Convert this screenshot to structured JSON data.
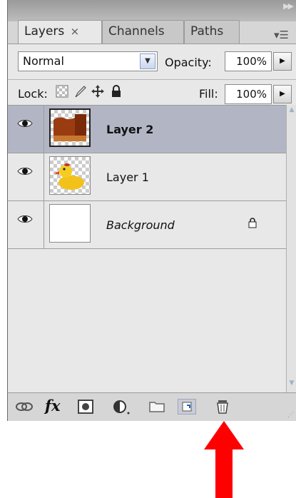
{
  "tabs": [
    {
      "label": "Layers",
      "close": "×",
      "active": true
    },
    {
      "label": "Channels",
      "active": false
    },
    {
      "label": "Paths",
      "active": false
    }
  ],
  "controls": {
    "blend_mode": "Normal",
    "opacity_label": "Opacity:",
    "opacity_value": "100%",
    "lock_label": "Lock:",
    "fill_label": "Fill:",
    "fill_value": "100%"
  },
  "layers": [
    {
      "name": "Layer 2",
      "visible": true,
      "selected": true,
      "thumbnail": "brown-image-thumbnail"
    },
    {
      "name": "Layer 1",
      "visible": true,
      "selected": false,
      "thumbnail": "rubber-duck-thumbnail"
    },
    {
      "name": "Background",
      "visible": true,
      "selected": false,
      "locked": true,
      "thumbnail": "white-thumbnail"
    }
  ],
  "footer_icons": [
    "link-layers-icon",
    "fx-icon",
    "layer-mask-icon",
    "adjustment-layer-icon",
    "group-folder-icon",
    "new-layer-icon",
    "trash-icon"
  ],
  "footer": {
    "fx_label": "fx"
  },
  "annotation": {
    "arrow_color": "#ff0000"
  },
  "colors": {
    "selected_row": "#b2b6c4",
    "panel_bg": "#e8e8e8"
  }
}
